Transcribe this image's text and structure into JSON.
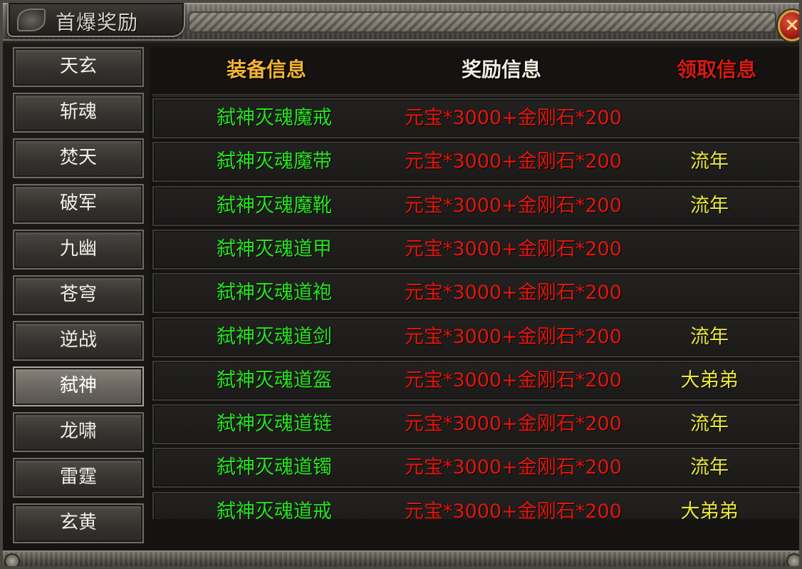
{
  "window": {
    "title": "首爆奖励",
    "close_label": "×"
  },
  "sidebar": {
    "active_index": 7,
    "items": [
      {
        "label": "天玄"
      },
      {
        "label": "斩魂"
      },
      {
        "label": "焚天"
      },
      {
        "label": "破军"
      },
      {
        "label": "九幽"
      },
      {
        "label": "苍穹"
      },
      {
        "label": "逆战"
      },
      {
        "label": "弑神"
      },
      {
        "label": "龙啸"
      },
      {
        "label": "雷霆"
      },
      {
        "label": "玄黄"
      }
    ]
  },
  "table": {
    "headers": {
      "equip": "装备信息",
      "reward": "奖励信息",
      "claim": "领取信息"
    },
    "rows": [
      {
        "equip": "弑神灭魂魔戒",
        "reward": "元宝*3000+金刚石*200",
        "claim": ""
      },
      {
        "equip": "弑神灭魂魔带",
        "reward": "元宝*3000+金刚石*200",
        "claim": "流年"
      },
      {
        "equip": "弑神灭魂魔靴",
        "reward": "元宝*3000+金刚石*200",
        "claim": "流年"
      },
      {
        "equip": "弑神灭魂道甲",
        "reward": "元宝*3000+金刚石*200",
        "claim": ""
      },
      {
        "equip": "弑神灭魂道袍",
        "reward": "元宝*3000+金刚石*200",
        "claim": ""
      },
      {
        "equip": "弑神灭魂道剑",
        "reward": "元宝*3000+金刚石*200",
        "claim": "流年"
      },
      {
        "equip": "弑神灭魂道盔",
        "reward": "元宝*3000+金刚石*200",
        "claim": "大弟弟"
      },
      {
        "equip": "弑神灭魂道链",
        "reward": "元宝*3000+金刚石*200",
        "claim": "流年"
      },
      {
        "equip": "弑神灭魂道镯",
        "reward": "元宝*3000+金刚石*200",
        "claim": "流年"
      },
      {
        "equip": "弑神灭魂道戒",
        "reward": "元宝*3000+金刚石*200",
        "claim": "大弟弟"
      }
    ]
  },
  "colors": {
    "equip_text": "#27e31f",
    "reward_text": "#e3160d",
    "claim_text": "#eae63a",
    "header_equip": "#f2b233",
    "header_reward": "#f1ece2",
    "header_claim": "#d81b10"
  }
}
